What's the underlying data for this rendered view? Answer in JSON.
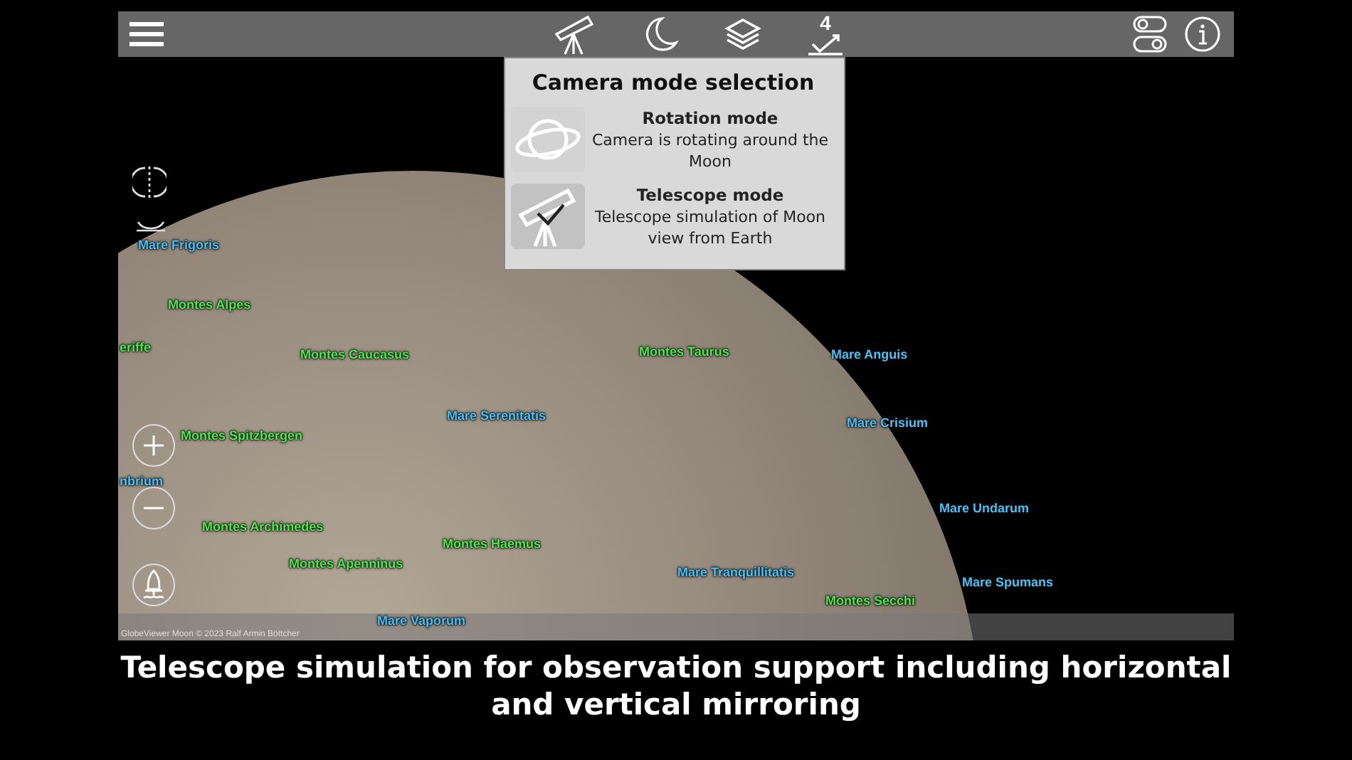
{
  "toolbar": {
    "badge": "4"
  },
  "camera_popup": {
    "title": "Camera mode selection",
    "modes": [
      {
        "kind": "rotation",
        "title": "Rotation mode",
        "description": "Camera is rotating around the Moon",
        "selected": false
      },
      {
        "kind": "telescope",
        "title": "Telescope mode",
        "description": "Telescope simulation of Moon view from Earth",
        "selected": true
      }
    ]
  },
  "map_labels": [
    {
      "text": "Mare Frigoris",
      "kind": "mare"
    },
    {
      "text": "Montes Alpes",
      "kind": "montes"
    },
    {
      "text": "eriffe",
      "kind": "montes"
    },
    {
      "text": "Montes Caucasus",
      "kind": "montes"
    },
    {
      "text": "Montes Spitzbergen",
      "kind": "montes"
    },
    {
      "text": "nbrium",
      "kind": "mare"
    },
    {
      "text": "Montes Archimedes",
      "kind": "montes"
    },
    {
      "text": "Montes Apenninus",
      "kind": "montes"
    },
    {
      "text": "Mare Serenitatis",
      "kind": "mare"
    },
    {
      "text": "Montes Haemus",
      "kind": "montes"
    },
    {
      "text": "Montes Taurus",
      "kind": "montes"
    },
    {
      "text": "Mare Anguis",
      "kind": "mare"
    },
    {
      "text": "Mare Crisium",
      "kind": "mare"
    },
    {
      "text": "Mare Undarum",
      "kind": "mare"
    },
    {
      "text": "Mare Tranquillitatis",
      "kind": "mare"
    },
    {
      "text": "Montes Secchi",
      "kind": "montes"
    },
    {
      "text": "Mare Spumans",
      "kind": "mare"
    },
    {
      "text": "Mare Vaporum",
      "kind": "mare"
    }
  ],
  "credit": "GlobeViewer Moon © 2023 Ralf Armin Böttcher",
  "caption": "Telescope simulation for observation support including horizontal and vertical mirroring"
}
